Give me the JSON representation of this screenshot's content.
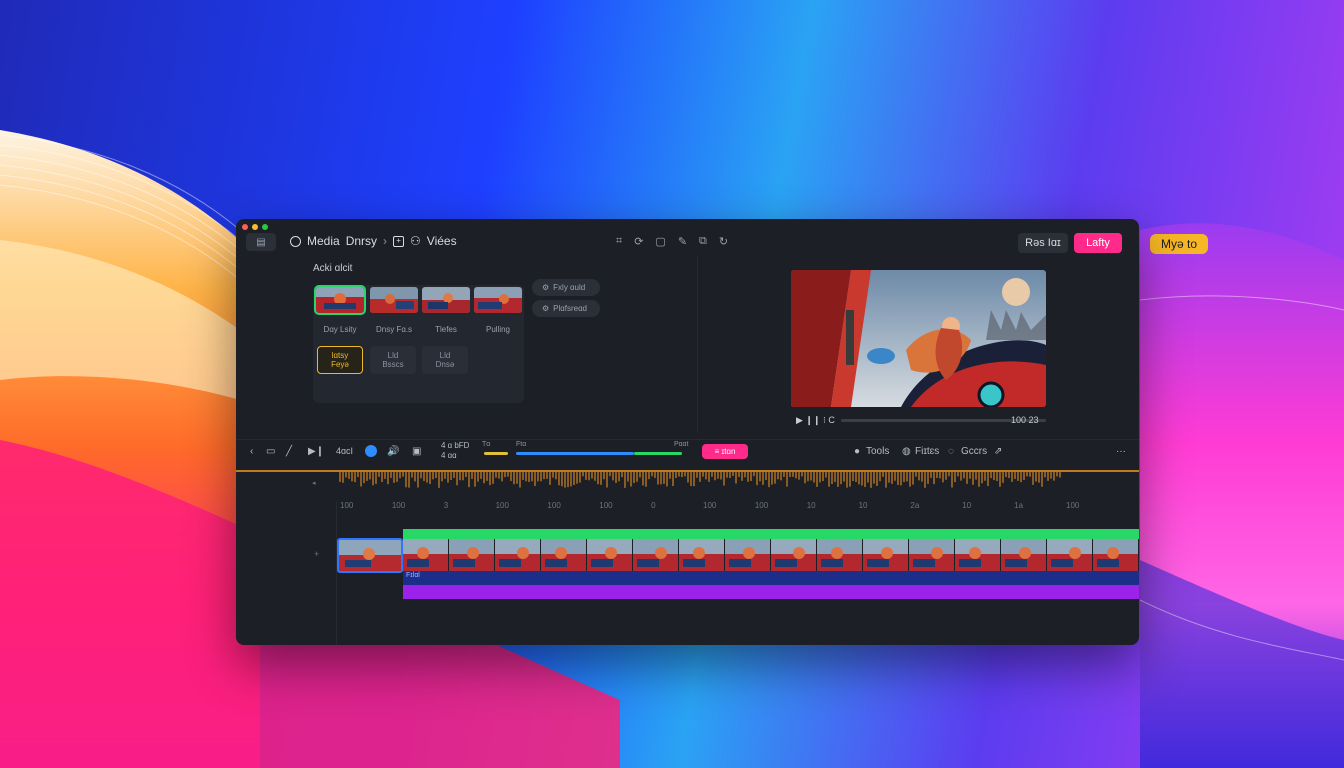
{
  "floating_badge": "Myə to",
  "window": {
    "breadcrumb": {
      "item1": "Media",
      "item2": "Dnrsy",
      "item3": "Viées"
    },
    "top_icons": [
      "⌗",
      "⟳",
      "▢",
      "✎",
      "⧉",
      "↻"
    ],
    "buttons": {
      "secondary": "Rəs Iɑɪ",
      "primary": "Lafty"
    },
    "media_panel": {
      "title": "Acki ɑlcit",
      "thumb_labels": [
        "Dɑy Lsity",
        "Dnsy Fɑ.s",
        "Tlefes",
        "Pulling"
      ],
      "tiles": [
        {
          "line1": "lɑtsy",
          "line2": "Feyə"
        },
        {
          "line1": "Lld",
          "line2": "Bsscs"
        },
        {
          "line1": "Lld",
          "line2": "Dnsə"
        }
      ],
      "pills": [
        "Fxly ɑuld",
        "Plɑfsreɑd"
      ]
    },
    "preview": {
      "transport": "▶ ❙❙ ⁝ C",
      "timecode": "100 23"
    },
    "toolbar": {
      "counter": "4ɑcI",
      "readout_top": "4 ɑ bFD",
      "readout_bottom": "4 ɑɑ",
      "meter_label_left": "Tɑ",
      "meter_label_mid": "Ftɑ",
      "meter_label_right": "Pɑɑt",
      "pink_button": "≡ ɪtɑn",
      "tools": "Tools",
      "filters": "Fiɪtɛs",
      "colors": "Gccrs",
      "menu": "···"
    },
    "ruler_ticks": [
      "100",
      "100",
      "3",
      "100",
      "100",
      "100",
      "0",
      "100",
      "100",
      "10",
      "10",
      "2a",
      "10",
      "1a",
      "100"
    ],
    "track_label": "Fɪlɑl",
    "colors": {
      "accent_pink": "#ff2a8a",
      "green_track": "#27d866",
      "purple_track": "#9b22ea",
      "waveform": "#f39a1f",
      "badge": "#f7b625"
    }
  }
}
